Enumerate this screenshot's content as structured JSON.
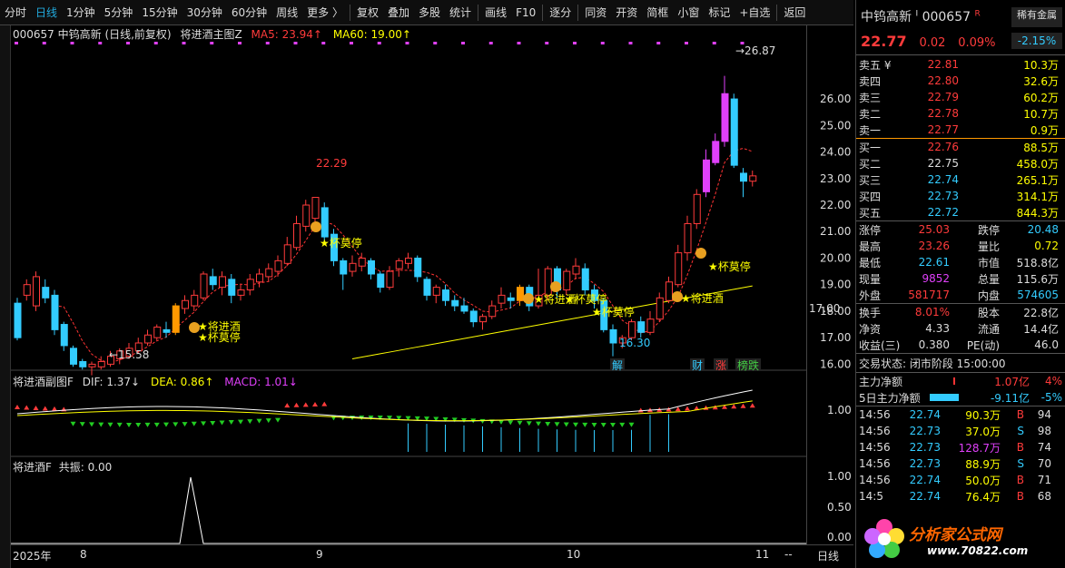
{
  "toolbar": {
    "items": [
      "分时",
      "日线",
      "1分钟",
      "5分钟",
      "15分钟",
      "30分钟",
      "60分钟",
      "周线",
      "更多 〉",
      "复权",
      "叠加",
      "多股",
      "统计",
      "画线",
      "F10",
      "逐分",
      "同资",
      "开资",
      "简框",
      "小窗",
      "标记",
      "+自选",
      "返回"
    ]
  },
  "main_panel": {
    "title": "000657  中钨高新 (日线,前复权)",
    "indicator": "将进酒主图Z",
    "ma5": "MA5: 23.94↑",
    "ma60": "MA60: 19.00↑",
    "price_current_tag": "17.00",
    "labels": {
      "high1": "22.29",
      "low1": "←15.58",
      "high2": "→26.87",
      "low2": "16.30",
      "sig_jjj": "★将进酒",
      "sig_bmt": "★杯莫停",
      "sig_jjj2": "★将进酒",
      "sig_bmt2": "★杯莫停",
      "sig_bmt3": "★杯莫停",
      "sig_bmt4": "★杯莫停",
      "sig_jjj3": "★将进酒",
      "sig_bmt5": "★杯莫停",
      "jie": "解",
      "cai": "财",
      "zhang": "涨",
      "bang": "榜跌"
    }
  },
  "sub_panel": {
    "title": "将进酒副图F",
    "dif": "DIF: 1.37↓",
    "dea": "DEA: 0.86↑",
    "macd": "MACD: 1.01↓",
    "ytick": "1.00"
  },
  "sub_panel2": {
    "title": "将进酒F",
    "gz": "共振: 0.00",
    "yticks": [
      "1.00",
      "0.50",
      "0.00"
    ]
  },
  "x_axis": {
    "labels": [
      "2025年",
      "8",
      "9",
      "10",
      "11"
    ],
    "period": "日线",
    "dashes": "--"
  },
  "chart_data": {
    "type": "candlestick",
    "yticks": [
      "26.00",
      "25.00",
      "24.00",
      "23.00",
      "22.00",
      "21.00",
      "20.00",
      "19.00",
      "18.00",
      "17.00",
      "16.00"
    ],
    "ylim": [
      15.5,
      27.2
    ],
    "candles": [
      [
        18.3,
        17.0,
        18.5,
        16.9
      ],
      [
        18.6,
        19.0,
        19.2,
        18.4
      ],
      [
        18.2,
        19.3,
        19.5,
        18.0
      ],
      [
        18.9,
        18.5,
        19.2,
        18.3
      ],
      [
        18.6,
        17.3,
        18.8,
        17.1
      ],
      [
        17.5,
        16.7,
        17.6,
        16.5
      ],
      [
        16.6,
        16.0,
        16.7,
        15.9
      ],
      [
        16.1,
        15.9,
        16.2,
        15.8
      ],
      [
        15.9,
        16.0,
        16.1,
        15.58
      ],
      [
        15.9,
        16.1,
        16.3,
        15.8
      ],
      [
        16.0,
        16.3,
        16.5,
        15.9
      ],
      [
        16.2,
        16.5,
        16.6,
        16.0
      ],
      [
        16.3,
        16.6,
        16.8,
        16.2
      ],
      [
        16.5,
        16.8,
        17.0,
        16.4
      ],
      [
        16.8,
        17.1,
        17.3,
        16.7
      ],
      [
        17.0,
        17.4,
        17.5,
        16.9
      ],
      [
        17.3,
        17.2,
        17.6,
        17.0
      ],
      [
        17.2,
        18.2,
        18.3,
        17.1
      ],
      [
        18.1,
        18.4,
        18.6,
        17.9
      ],
      [
        18.2,
        18.6,
        18.8,
        18.0
      ],
      [
        18.5,
        19.4,
        19.5,
        18.4
      ],
      [
        19.3,
        19.0,
        19.6,
        18.8
      ],
      [
        18.9,
        19.3,
        19.5,
        18.6
      ],
      [
        19.2,
        18.6,
        19.4,
        18.3
      ],
      [
        18.6,
        18.8,
        19.0,
        18.4
      ],
      [
        18.8,
        19.2,
        19.4,
        18.6
      ],
      [
        19.1,
        19.4,
        19.6,
        18.9
      ],
      [
        19.3,
        19.6,
        19.8,
        19.1
      ],
      [
        19.5,
        19.9,
        20.1,
        19.3
      ],
      [
        19.8,
        20.5,
        20.8,
        19.7
      ],
      [
        20.4,
        21.3,
        21.6,
        20.3
      ],
      [
        21.2,
        22.0,
        22.2,
        21.0
      ],
      [
        21.5,
        22.29,
        22.29,
        21.3
      ],
      [
        21.9,
        20.8,
        22.1,
        20.6
      ],
      [
        20.9,
        19.9,
        21.1,
        19.7
      ],
      [
        19.9,
        19.4,
        20.0,
        18.8
      ],
      [
        19.5,
        19.8,
        20.1,
        19.3
      ],
      [
        19.7,
        20.0,
        20.2,
        19.5
      ],
      [
        19.9,
        19.4,
        20.0,
        19.2
      ],
      [
        19.4,
        18.9,
        19.5,
        18.7
      ],
      [
        18.9,
        19.5,
        19.7,
        18.8
      ],
      [
        19.6,
        19.9,
        20.0,
        19.3
      ],
      [
        19.8,
        20.0,
        20.2,
        19.6
      ],
      [
        20.0,
        19.3,
        20.1,
        19.1
      ],
      [
        19.2,
        18.6,
        19.3,
        18.4
      ],
      [
        18.6,
        18.9,
        19.0,
        18.3
      ],
      [
        18.8,
        18.4,
        19.0,
        18.2
      ],
      [
        18.4,
        18.2,
        18.6,
        18.0
      ],
      [
        18.2,
        18.0,
        18.5,
        17.9
      ],
      [
        18.0,
        17.6,
        18.1,
        17.4
      ],
      [
        17.6,
        17.8,
        17.9,
        17.3
      ],
      [
        17.8,
        18.2,
        18.4,
        17.7
      ],
      [
        18.3,
        18.6,
        18.9,
        18.1
      ],
      [
        18.5,
        18.4,
        18.7,
        18.1
      ],
      [
        18.4,
        18.9,
        19.0,
        18.2
      ],
      [
        18.9,
        18.2,
        19.0,
        18.0
      ],
      [
        18.2,
        18.6,
        19.6,
        18.1
      ],
      [
        18.6,
        19.6,
        19.7,
        18.4
      ],
      [
        19.6,
        18.8,
        19.7,
        18.5
      ],
      [
        18.8,
        19.5,
        19.6,
        18.6
      ],
      [
        19.4,
        19.7,
        20.0,
        19.2
      ],
      [
        19.6,
        18.8,
        19.8,
        18.6
      ],
      [
        18.8,
        18.4,
        19.0,
        18.1
      ],
      [
        18.4,
        17.3,
        18.5,
        17.2
      ],
      [
        17.3,
        16.8,
        17.5,
        16.3
      ],
      [
        16.8,
        17.0,
        17.1,
        16.6
      ],
      [
        17.0,
        17.6,
        17.7,
        16.9
      ],
      [
        17.6,
        17.2,
        17.8,
        17.0
      ],
      [
        17.2,
        17.7,
        18.0,
        17.1
      ],
      [
        17.7,
        18.5,
        18.7,
        17.6
      ],
      [
        18.4,
        19.1,
        19.3,
        18.3
      ],
      [
        19.0,
        20.2,
        20.5,
        18.9
      ],
      [
        20.2,
        21.3,
        21.6,
        19.9
      ],
      [
        21.3,
        22.4,
        22.6,
        21.1
      ],
      [
        22.5,
        23.7,
        24.1,
        22.3
      ],
      [
        23.6,
        24.4,
        24.7,
        23.5
      ],
      [
        24.4,
        26.2,
        26.87,
        24.2
      ],
      [
        26.0,
        23.5,
        26.2,
        23.4
      ],
      [
        23.2,
        22.9,
        23.4,
        22.3
      ],
      [
        22.9,
        23.1,
        23.3,
        22.7
      ]
    ]
  },
  "right_panel": {
    "stock_name": "中钨高新",
    "code_mark": "I",
    "code": "000657",
    "tag": "R",
    "rare_metal": "稀有金属",
    "price": "22.77",
    "change": "0.02",
    "pct": "0.09%",
    "rare_pct": "-2.15%",
    "asks": [
      [
        "卖五 ¥",
        "22.81",
        "10.3万"
      ],
      [
        "卖四",
        "22.80",
        "32.6万"
      ],
      [
        "卖三",
        "22.79",
        "60.2万"
      ],
      [
        "卖二",
        "22.78",
        "10.7万"
      ],
      [
        "卖一",
        "22.77",
        "0.9万"
      ]
    ],
    "bids": [
      [
        "买一",
        "22.76",
        "88.5万"
      ],
      [
        "买二",
        "22.75",
        "458.0万"
      ],
      [
        "买三",
        "22.74",
        "265.1万"
      ],
      [
        "买四",
        "22.73",
        "314.1万"
      ],
      [
        "买五",
        "22.72",
        "844.3万"
      ]
    ],
    "stats": [
      [
        "涨停",
        "25.03",
        "跌停",
        "20.48"
      ],
      [
        "最高",
        "23.26",
        "量比",
        "0.72"
      ],
      [
        "最低",
        "22.61",
        "市值",
        "518.8亿"
      ],
      [
        "现量",
        "9852",
        "总量",
        "115.6万"
      ],
      [
        "外盘",
        "581717",
        "内盘",
        "574605"
      ]
    ],
    "stats2": [
      [
        "换手",
        "8.01%",
        "股本",
        "22.8亿"
      ],
      [
        "净资",
        "4.33",
        "流通",
        "14.4亿"
      ],
      [
        "收益(三)",
        "0.380",
        "PE(动)",
        "46.0"
      ]
    ],
    "trade_status": "交易状态: 闭市阶段 15:00:00",
    "flow": [
      [
        "主力净额",
        "1.07亿",
        "4%"
      ],
      [
        "5日主力净额",
        "-9.11亿",
        "-5%"
      ]
    ],
    "ticks": [
      [
        "14:56",
        "22.74",
        "90.3万",
        "B",
        "94"
      ],
      [
        "14:56",
        "22.73",
        "37.0万",
        "S",
        "98"
      ],
      [
        "14:56",
        "22.73",
        "128.7万",
        "B",
        "74"
      ],
      [
        "14:56",
        "22.73",
        "88.9万",
        "S",
        "70"
      ],
      [
        "14:56",
        "22.74",
        "50.0万",
        "B",
        "71"
      ],
      [
        "14:5",
        "22.74",
        "76.4万",
        "B",
        "68"
      ]
    ],
    "watermark": "分析家公式网",
    "watermark_url": "www.70822.com"
  }
}
